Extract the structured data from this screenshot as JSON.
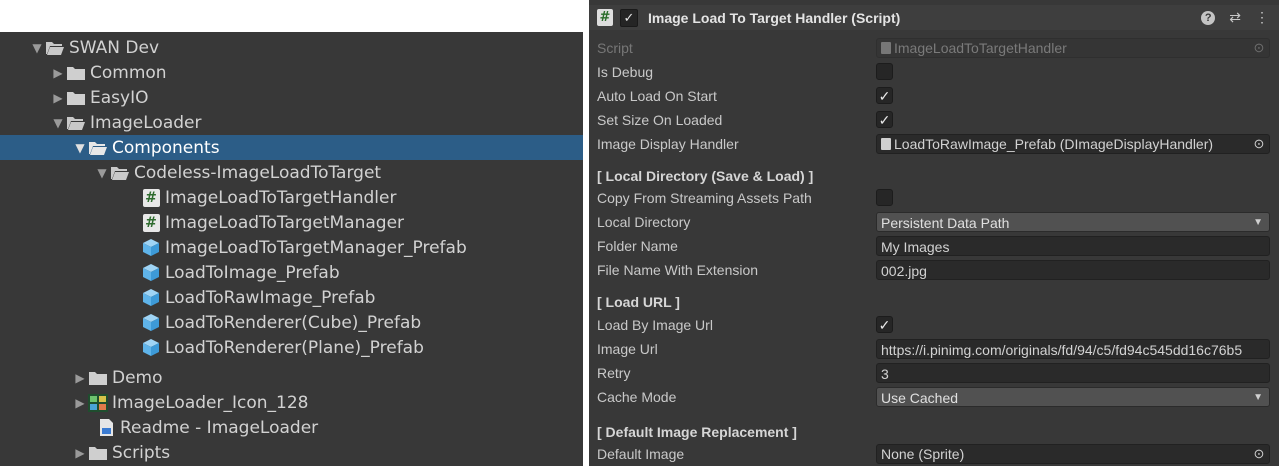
{
  "project": {
    "items": [
      {
        "label": "SWAN Dev",
        "arrow": "▼",
        "icon": "folder-open-icon"
      },
      {
        "label": "Common",
        "arrow": "▶",
        "icon": "folder-icon"
      },
      {
        "label": "EasyIO",
        "arrow": "▶",
        "icon": "folder-icon"
      },
      {
        "label": "ImageLoader",
        "arrow": "▼",
        "icon": "folder-open-icon"
      },
      {
        "label": "Components",
        "arrow": "▼",
        "icon": "folder-open-icon",
        "selected": true
      },
      {
        "label": "Codeless-ImageLoadToTarget",
        "arrow": "▼",
        "icon": "folder-open-icon"
      },
      {
        "label": "ImageLoadToTargetHandler",
        "arrow": "",
        "icon": "script-icon"
      },
      {
        "label": "ImageLoadToTargetManager",
        "arrow": "",
        "icon": "script-icon"
      },
      {
        "label": "ImageLoadToTargetManager_Prefab",
        "arrow": "",
        "icon": "prefab-icon"
      },
      {
        "label": "LoadToImage_Prefab",
        "arrow": "",
        "icon": "prefab-icon"
      },
      {
        "label": "LoadToRawImage_Prefab",
        "arrow": "",
        "icon": "prefab-icon"
      },
      {
        "label": "LoadToRenderer(Cube)_Prefab",
        "arrow": "",
        "icon": "prefab-icon"
      },
      {
        "label": "LoadToRenderer(Plane)_Prefab",
        "arrow": "",
        "icon": "prefab-icon"
      },
      {
        "label": "Demo",
        "arrow": "▶",
        "icon": "folder-icon"
      },
      {
        "label": "ImageLoader_Icon_128",
        "arrow": "▶",
        "icon": "image-icon"
      },
      {
        "label": "Readme - ImageLoader",
        "arrow": "",
        "icon": "readme-icon"
      },
      {
        "label": "Scripts",
        "arrow": "▶",
        "icon": "folder-icon"
      }
    ]
  },
  "inspector": {
    "header": {
      "title": "Image Load To Target Handler (Script)",
      "enabled_mark": "✓",
      "script_badge": "#",
      "help_icon": "?",
      "settings_icon": "⇄",
      "menu_icon": "⋮"
    },
    "script": {
      "label": "Script",
      "value": "ImageLoadToTargetHandler"
    },
    "is_debug": {
      "label": "Is Debug",
      "checked": ""
    },
    "auto_load": {
      "label": "Auto Load On Start",
      "checked": "✓"
    },
    "set_size": {
      "label": "Set Size On Loaded",
      "checked": "✓"
    },
    "display_handler": {
      "label": "Image Display Handler",
      "value": "LoadToRawImage_Prefab (DImageDisplayHandler)"
    },
    "local_section": "[ Local Directory (Save & Load) ]",
    "copy_streaming": {
      "label": "Copy From Streaming Assets Path",
      "checked": ""
    },
    "local_directory": {
      "label": "Local Directory",
      "value": "Persistent Data Path"
    },
    "folder_name": {
      "label": "Folder Name",
      "value": "My Images"
    },
    "file_name": {
      "label": "File Name With Extension",
      "value": "002.jpg"
    },
    "url_section": "[ Load URL ]",
    "load_by_url": {
      "label": "Load By Image Url",
      "checked": "✓"
    },
    "image_url": {
      "label": "Image Url",
      "value": "https://i.pinimg.com/originals/fd/94/c5/fd94c545dd16c76b5"
    },
    "retry": {
      "label": "Retry",
      "value": "3"
    },
    "cache_mode": {
      "label": "Cache Mode",
      "value": "Use Cached"
    },
    "default_section": "[ Default Image Replacement ]",
    "default_image": {
      "label": "Default Image",
      "value": "None (Sprite)"
    },
    "picker_glyph": "⊙",
    "dropdown_glyph": "▼"
  }
}
